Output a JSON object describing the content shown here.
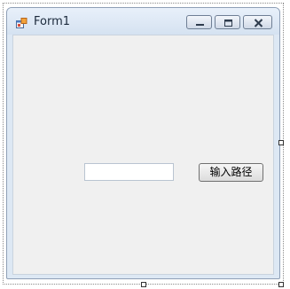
{
  "window": {
    "title": "Form1",
    "icon": "form-app-icon",
    "controls": {
      "minimize_icon": "minimize-icon",
      "maximize_icon": "maximize-icon",
      "close_icon": "close-icon"
    }
  },
  "form": {
    "path_input": {
      "value": "",
      "placeholder": ""
    },
    "path_button_label": "输入路径"
  },
  "colors": {
    "titlebar": "#dde8f4",
    "client_background": "#f0f0f0",
    "window_border": "#8e9fb6"
  }
}
